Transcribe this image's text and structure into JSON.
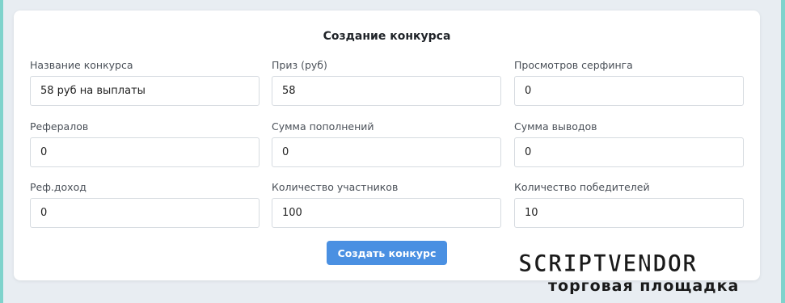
{
  "form": {
    "title": "Создание конкурса",
    "fields": {
      "name": {
        "label": "Название конкурса",
        "value": "58 руб на выплаты"
      },
      "prize": {
        "label": "Приз (руб)",
        "value": "58"
      },
      "surf_views": {
        "label": "Просмотров серфинга",
        "value": "0"
      },
      "referrals": {
        "label": "Рефералов",
        "value": "0"
      },
      "deposits_sum": {
        "label": "Сумма пополнений",
        "value": "0"
      },
      "withdrawals_sum": {
        "label": "Сумма выводов",
        "value": "0"
      },
      "ref_income": {
        "label": "Реф.доход",
        "value": "0"
      },
      "participants_count": {
        "label": "Количество участников",
        "value": "100"
      },
      "winners_count": {
        "label": "Количество победителей",
        "value": "10"
      }
    },
    "submit_label": "Создать конкурс"
  },
  "watermark": {
    "brand": "SCRIPTVENDOR",
    "tagline": "торговая площадка"
  },
  "colors": {
    "accent": "#4a90e2",
    "side_strip": "#7fd3cc",
    "page_bg": "#e8edf2"
  }
}
